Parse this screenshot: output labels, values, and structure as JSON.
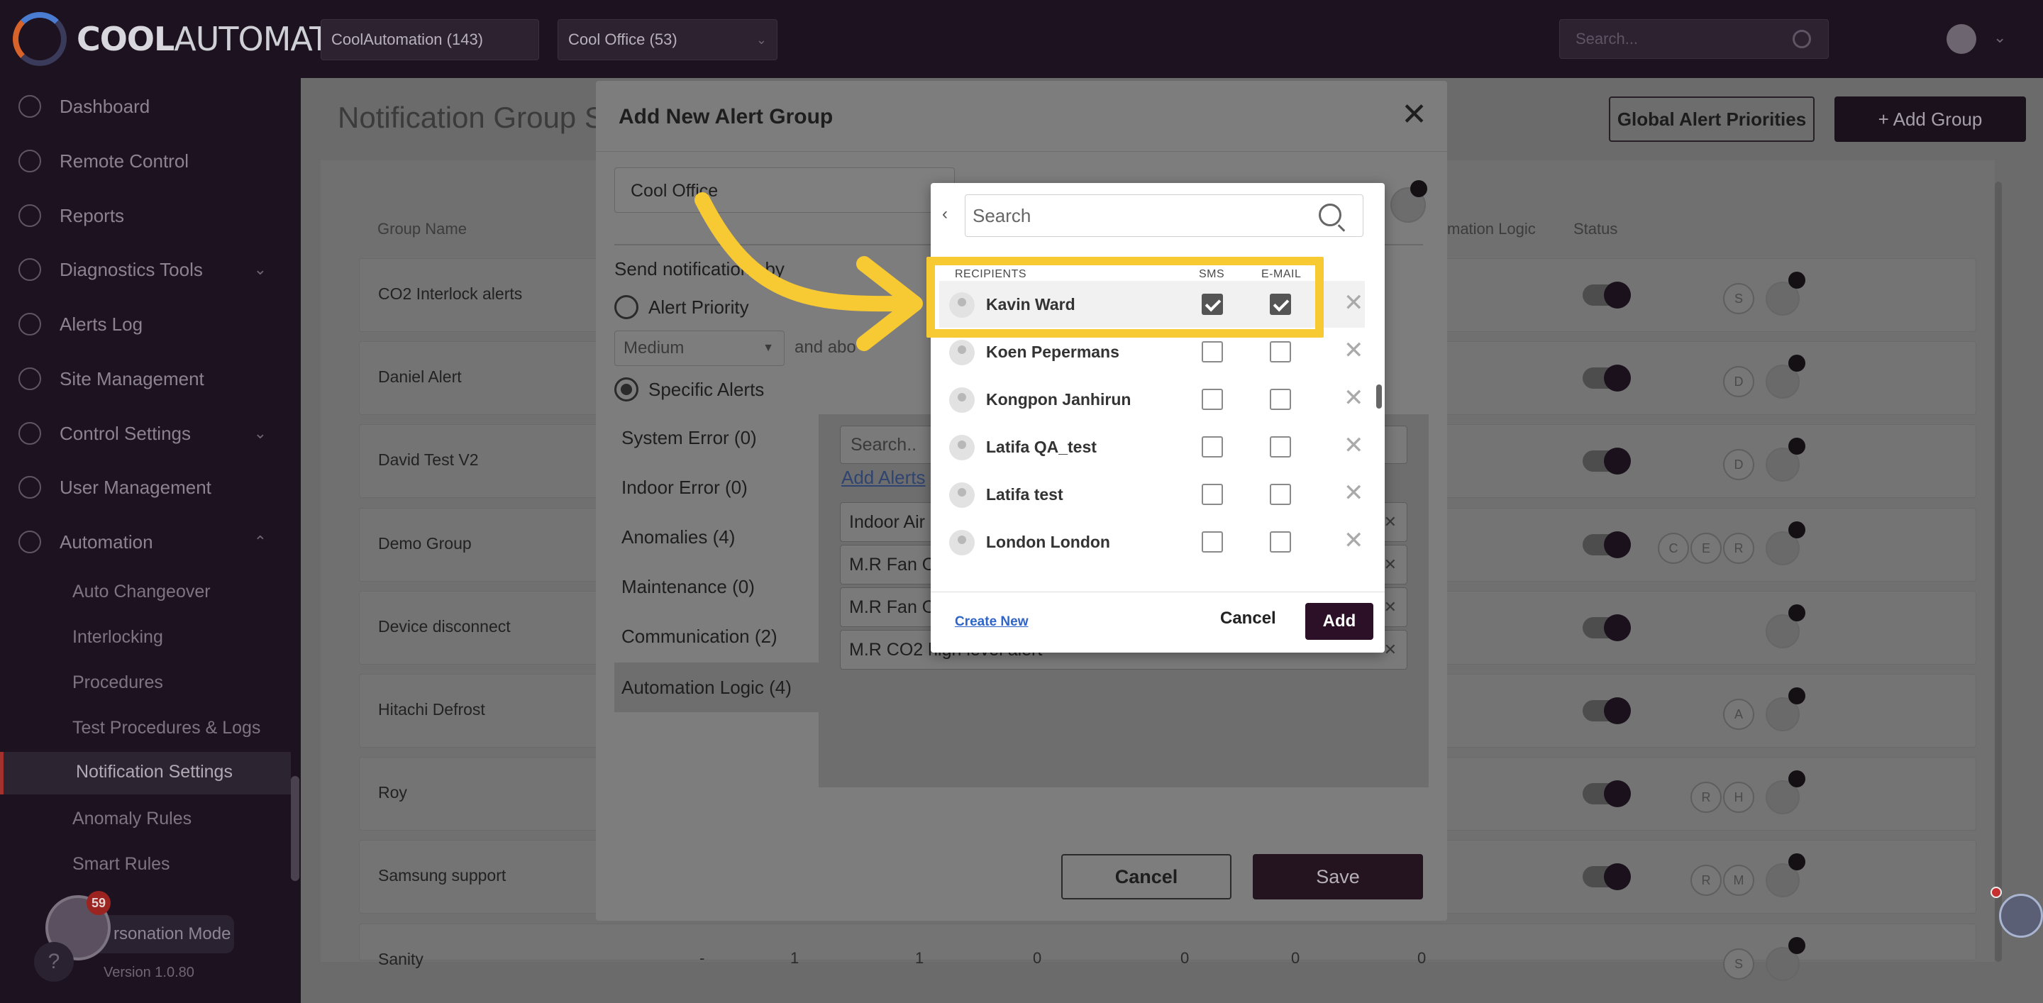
{
  "app": {
    "logo_bold": "COOL",
    "logo_rest": "AUTOMATION"
  },
  "topbar": {
    "customer_select": "CoolAutomation (143)",
    "site_select": "Cool Office (53)",
    "search_placeholder": "Search..."
  },
  "sidebar": {
    "items": [
      {
        "label": "Dashboard"
      },
      {
        "label": "Remote Control"
      },
      {
        "label": "Reports"
      },
      {
        "label": "Diagnostics Tools"
      },
      {
        "label": "Alerts Log"
      },
      {
        "label": "Site Management"
      },
      {
        "label": "Control Settings"
      },
      {
        "label": "User Management"
      },
      {
        "label": "Automation"
      }
    ],
    "sub_items": [
      {
        "label": "Auto Changeover"
      },
      {
        "label": "Interlocking"
      },
      {
        "label": "Procedures"
      },
      {
        "label": "Test Procedures & Logs"
      },
      {
        "label": "Notification Settings"
      },
      {
        "label": "Anomaly Rules"
      },
      {
        "label": "Smart Rules"
      }
    ],
    "impersonation_label": "rsonation Mode",
    "impersonation_badge": "59",
    "help": "?",
    "version": "Version 1.0.80"
  },
  "main": {
    "page_title": "Notification Group S",
    "global_priorities_btn": "Global Alert Priorities",
    "add_group_btn": "+ Add Group",
    "col_group_name": "Group Name",
    "col_automation_logic": "mation Logic",
    "col_status": "Status",
    "rows": [
      {
        "name": "CO2 Interlock alerts",
        "chips": [
          "S"
        ]
      },
      {
        "name": "Daniel Alert",
        "chips": [
          "D"
        ]
      },
      {
        "name": "David Test V2",
        "chips": [
          "D"
        ]
      },
      {
        "name": "Demo Group",
        "chips": [
          "C",
          "E",
          "R"
        ]
      },
      {
        "name": "Device disconnect",
        "chips": []
      },
      {
        "name": "Hitachi Defrost",
        "chips": [
          "A"
        ]
      },
      {
        "name": "Roy",
        "chips": [
          "R",
          "H"
        ]
      },
      {
        "name": "Samsung support",
        "chips": [
          "R",
          "M"
        ]
      },
      {
        "name": "Sanity",
        "chips": [
          "S"
        ]
      }
    ],
    "sanity_values": [
      "-",
      "1",
      "1",
      "0",
      "0",
      "0",
      "0"
    ]
  },
  "modal": {
    "title": "Add New Alert Group",
    "close": "✕",
    "site_field": "Cool Office",
    "send_by_label": "Send notifications by",
    "option_priority": "Alert Priority",
    "priority_value": "Medium",
    "and_above": "and abo",
    "option_specific": "Specific Alerts",
    "categories": [
      {
        "label": "System Error (0)"
      },
      {
        "label": "Indoor Error (0)"
      },
      {
        "label": "Anomalies (4)"
      },
      {
        "label": "Maintenance (0)"
      },
      {
        "label": "Communication (2)"
      },
      {
        "label": "Automation Logic (4)"
      }
    ],
    "alerts_search_placeholder": "Search..",
    "add_alerts_link": "Add Alerts",
    "alerts": [
      {
        "label": "Indoor Air"
      },
      {
        "label": "M.R Fan O"
      },
      {
        "label": "M.R Fan O"
      },
      {
        "label": "M.R CO2 high level alert"
      }
    ],
    "cancel": "Cancel",
    "save": "Save"
  },
  "recipients": {
    "search_placeholder": "Search",
    "header_recipients": "RECIPIENTS",
    "header_sms": "SMS",
    "header_email": "E-MAIL",
    "list": [
      {
        "name": "Kavin Ward",
        "sms": true,
        "email": true
      },
      {
        "name": "Koen Pepermans",
        "sms": false,
        "email": false
      },
      {
        "name": "Kongpon Janhirun",
        "sms": false,
        "email": false
      },
      {
        "name": "Latifa QA_test",
        "sms": false,
        "email": false
      },
      {
        "name": "Latifa test",
        "sms": false,
        "email": false
      },
      {
        "name": "London London",
        "sms": false,
        "email": false
      }
    ],
    "create_new": "Create New",
    "cancel": "Cancel",
    "add": "Add"
  },
  "colors": {
    "highlight": "#f7c933",
    "primary": "#2b1028"
  }
}
